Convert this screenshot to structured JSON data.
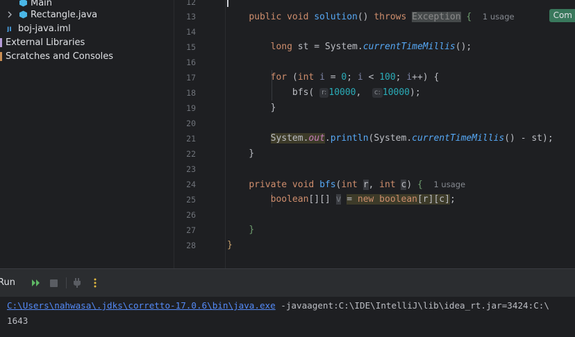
{
  "project_tree": {
    "items": [
      {
        "label": "Main",
        "icon": "java-class-icon"
      },
      {
        "label": "Rectangle.java",
        "icon": "java-class-icon"
      },
      {
        "label": "boj-java.iml",
        "icon": "iml-file-icon"
      },
      {
        "label": "External Libraries",
        "icon": "library-icon"
      },
      {
        "label": "Scratches and Consoles",
        "icon": "scratch-icon"
      }
    ]
  },
  "editor": {
    "line_numbers": [
      "12",
      "13",
      "14",
      "15",
      "16",
      "17",
      "18",
      "19",
      "20",
      "21",
      "22",
      "23",
      "24",
      "25",
      "26",
      "27",
      "28"
    ],
    "usage_hint_13": "1 usage",
    "usage_hint_24": "1 usage",
    "inlay_r": "r:",
    "inlay_c": "c:",
    "com_badge": "Com",
    "colors": {
      "keyword": "#cf8e6d",
      "method": "#56a8f5",
      "number": "#2aacb8",
      "field": "#c77dbb"
    }
  },
  "run": {
    "title": "Run",
    "console_path": "C:\\Users\\nahwasa\\.jdks\\corretto-17.0.6\\bin\\java.exe",
    "console_args": " -javaagent:C:\\IDE\\IntelliJ\\lib\\idea_rt.jar=3424:C:\\",
    "output": "1643"
  }
}
